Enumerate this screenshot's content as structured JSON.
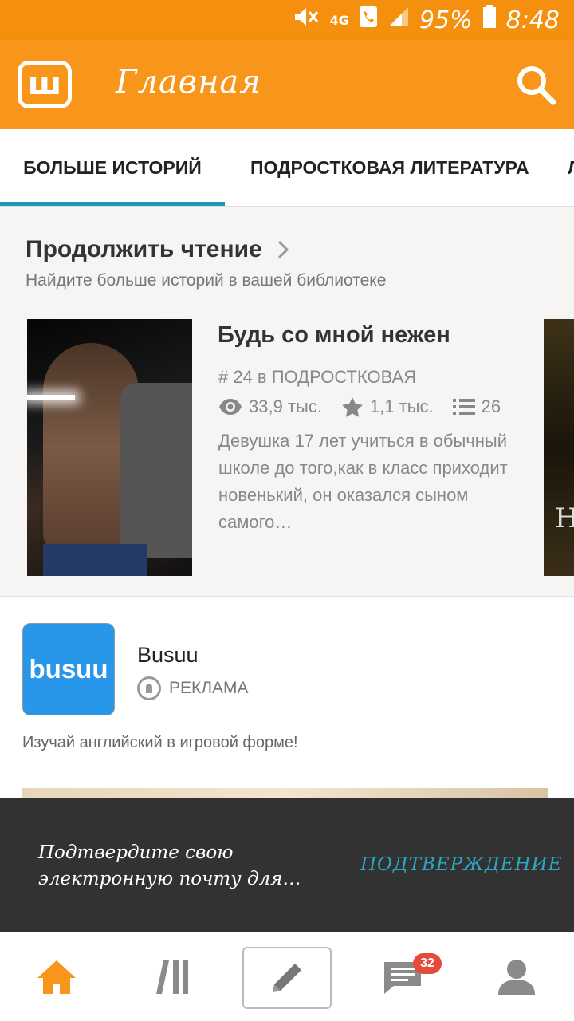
{
  "status_bar": {
    "battery": "95%",
    "time": "8:48",
    "network": "4G"
  },
  "app_bar": {
    "logo_letter": "ш",
    "title": "Главная"
  },
  "tabs": [
    {
      "label": "БОЛЬШЕ ИСТОРИЙ",
      "active": true
    },
    {
      "label": "ПОДРОСТКОВАЯ ЛИТЕРАТУРА",
      "active": false
    },
    {
      "label": "Л",
      "active": false
    }
  ],
  "continue_reading": {
    "title": "Продолжить чтение",
    "subtitle": "Найдите больше историй в вашей библиотеке",
    "book": {
      "title": "Будь со мной нежен",
      "rank": "# 24 в ПОДРОСТКОВАЯ",
      "views": "33,9 тыс.",
      "votes": "1,1 тыс.",
      "parts": "26",
      "description": "Девушка 17 лет учиться в обычный школе до того,как в класс приходит новенький, он оказался сыном самого…"
    },
    "next_cover_letter": "Н"
  },
  "ad": {
    "icon_text": "busuu",
    "name": "Busuu",
    "badge": "РЕКЛАМА",
    "text": "Изучай английский в игровой форме!"
  },
  "snackbar": {
    "message": "Подтвердите свою электронную почту для…",
    "action": "ПОДТВЕРЖДЕНИЕ"
  },
  "bottom_nav": {
    "messages_badge": "32"
  },
  "colors": {
    "accent": "#f7961a",
    "tab_indicator": "#159bb3",
    "snack_action": "#2aa8c2",
    "badge": "#e44b3a"
  }
}
